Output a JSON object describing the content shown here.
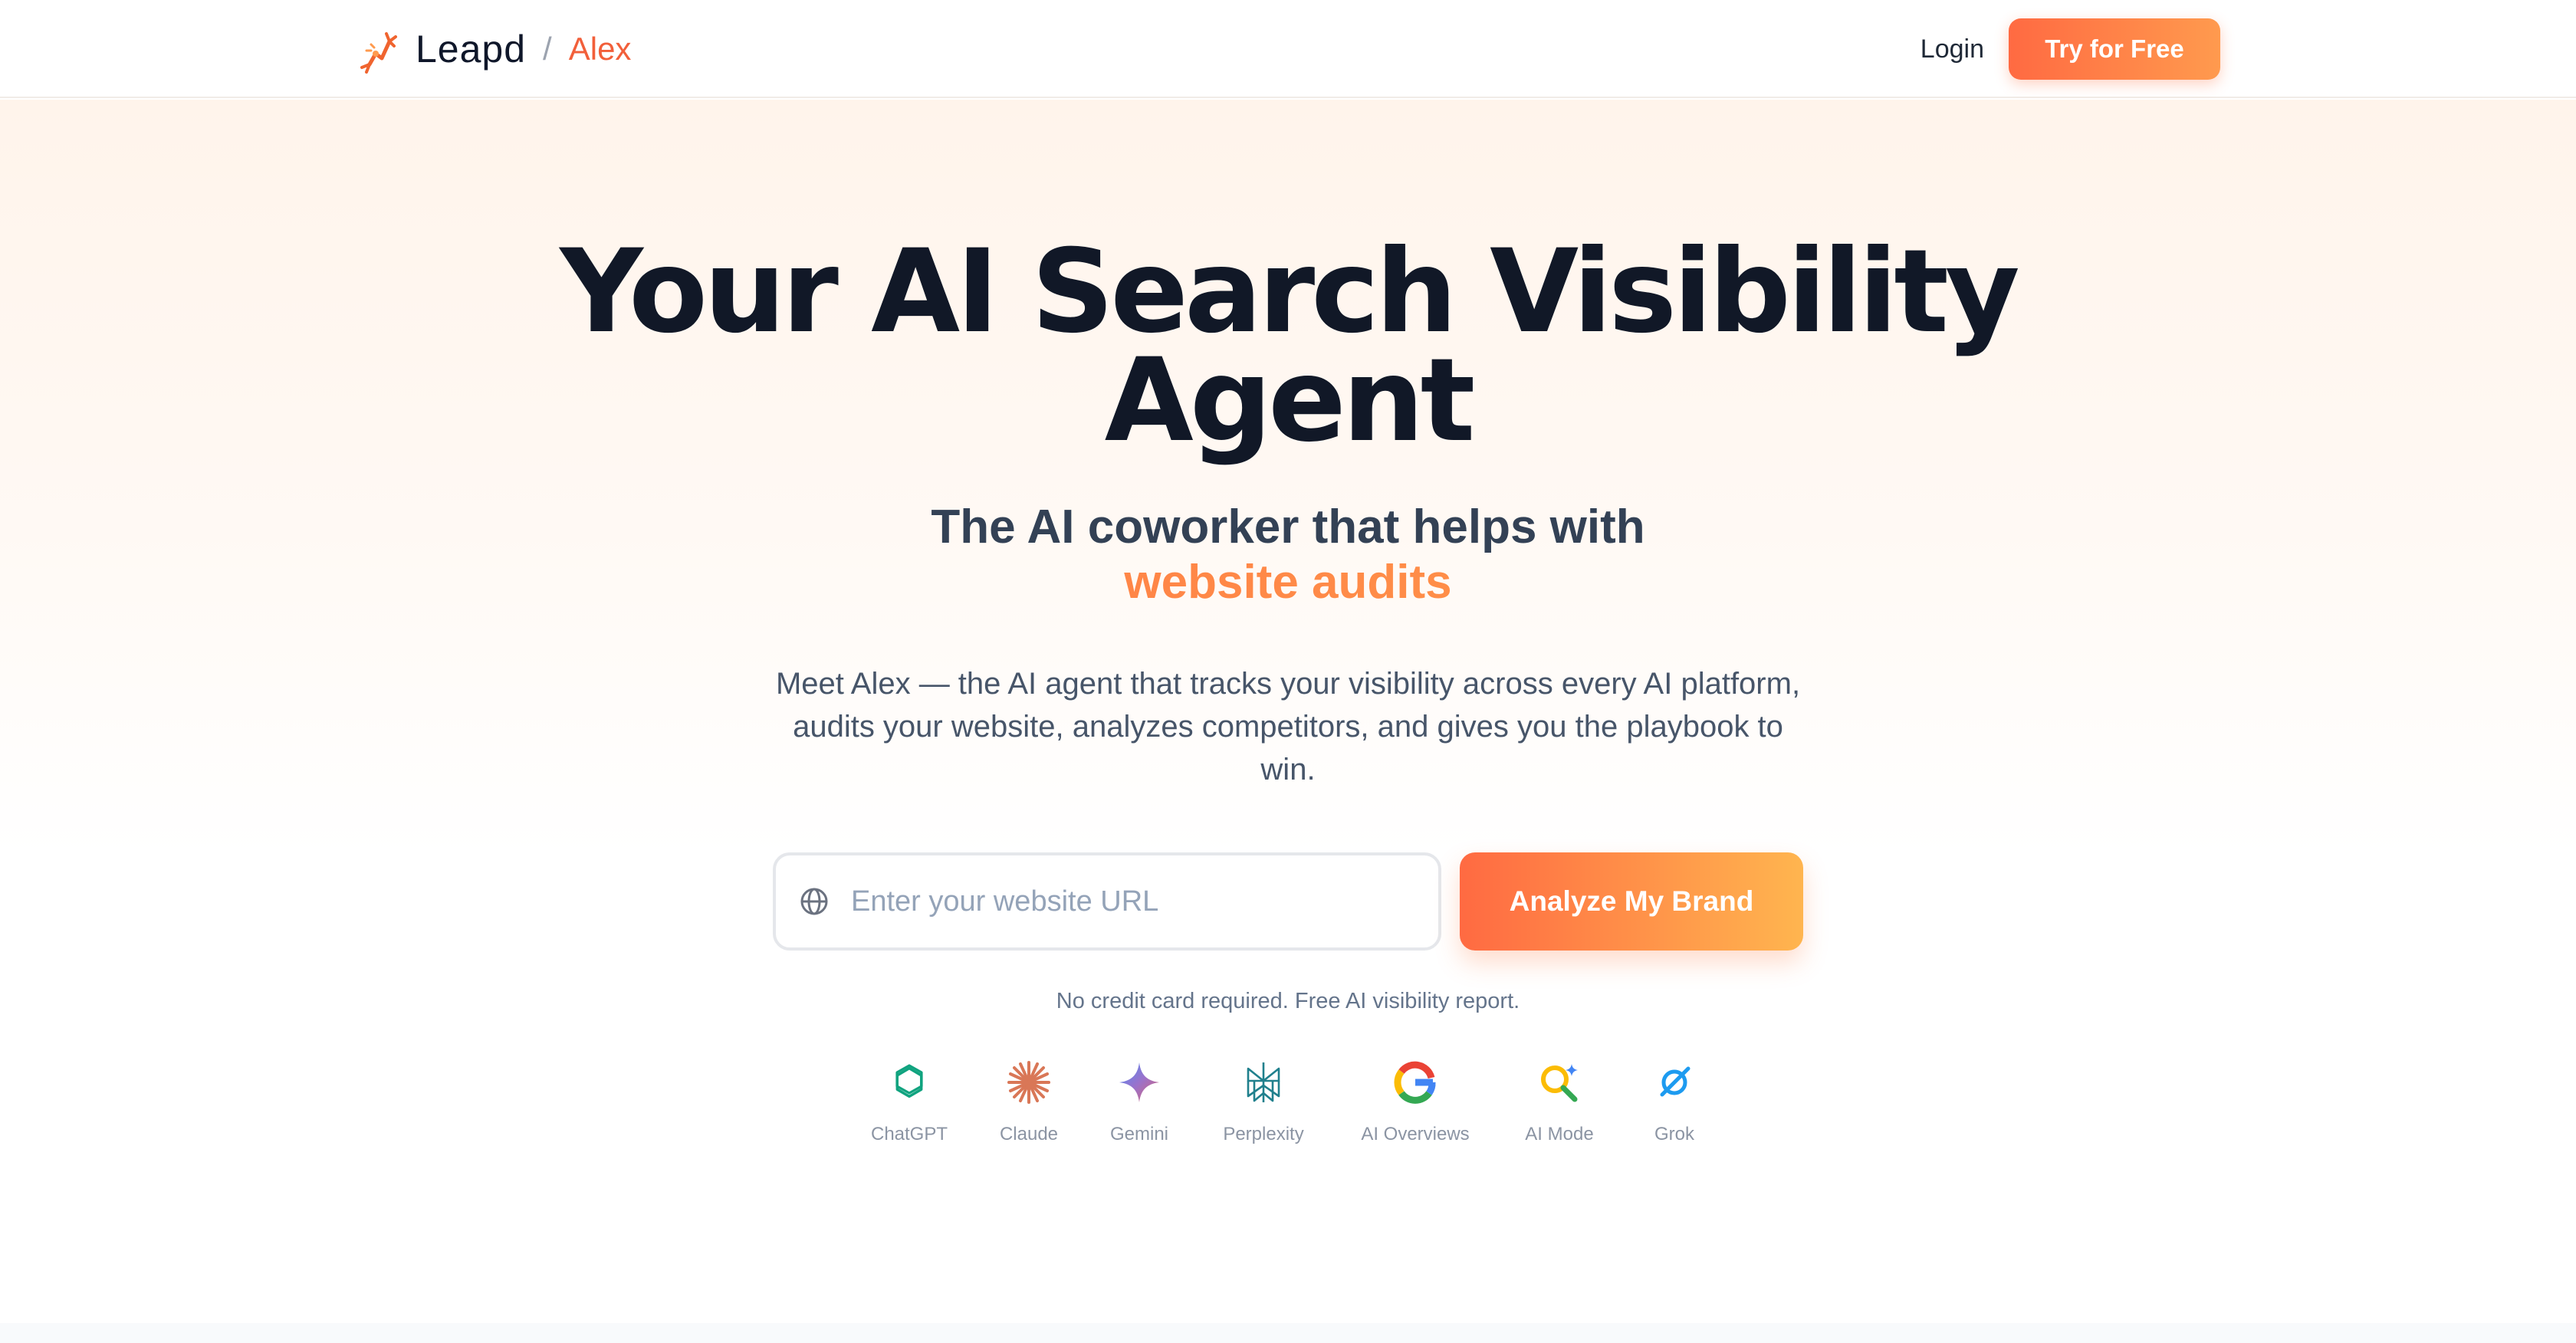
{
  "header": {
    "brand_name": "Leapd",
    "brand_separator": "/",
    "product_name": "Alex",
    "login_label": "Login",
    "cta_label": "Try for Free"
  },
  "hero": {
    "title_line1": "Your AI Search Visibility",
    "title_line2": "Agent",
    "subtitle": "The AI coworker that helps with",
    "subtitle_accent": "website audits",
    "description": "Meet Alex — the AI agent that tracks your visibility across every AI platform, audits your website, analyzes competitors, and gives you the playbook to win.",
    "url_placeholder": "Enter your website URL",
    "url_value": "",
    "analyze_label": "Analyze My Brand",
    "note": "No credit card required. Free AI visibility report."
  },
  "platforms": [
    {
      "label": "ChatGPT",
      "icon": "chatgpt-icon"
    },
    {
      "label": "Claude",
      "icon": "claude-icon"
    },
    {
      "label": "Gemini",
      "icon": "gemini-icon"
    },
    {
      "label": "Perplexity",
      "icon": "perplexity-icon"
    },
    {
      "label": "AI Overviews",
      "icon": "google-icon"
    },
    {
      "label": "AI Mode",
      "icon": "ai-mode-icon"
    },
    {
      "label": "Grok",
      "icon": "grok-icon"
    }
  ],
  "colors": {
    "accent_start": "#ff6a42",
    "accent_end": "#ffb54f",
    "heading": "#111827",
    "body_text": "#475569"
  }
}
